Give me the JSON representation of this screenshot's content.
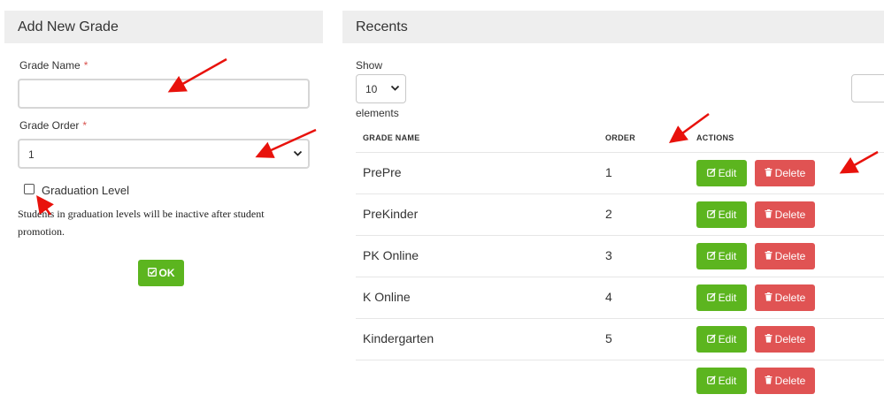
{
  "left_panel": {
    "title": "Add New Grade",
    "grade_name_label": "Grade Name",
    "grade_name_value": "",
    "required_mark": "*",
    "grade_order_label": "Grade Order",
    "grade_order_value": "1",
    "graduation_label": "Graduation Level",
    "graduation_checked": false,
    "help_text": "Students in graduation levels will be inactive after student promotion.",
    "ok_label": "OK"
  },
  "right_panel": {
    "title": "Recents",
    "show_label": "Show",
    "page_size": "10",
    "elements_label": "elements",
    "search_value": "",
    "columns": [
      "GRADE NAME",
      "ORDER",
      "ACTIONS"
    ],
    "edit_label": "Edit",
    "delete_label": "Delete",
    "rows": [
      {
        "name": "PrePre",
        "order": "1"
      },
      {
        "name": "PreKinder",
        "order": "2"
      },
      {
        "name": "PK Online",
        "order": "3"
      },
      {
        "name": "K Online",
        "order": "4"
      },
      {
        "name": "Kindergarten",
        "order": "5"
      }
    ]
  },
  "colors": {
    "accent_green": "#5cb51f",
    "danger_red": "#e05353",
    "annotation_red": "#e8120c"
  },
  "icons": {
    "ok": "check-square-icon",
    "edit": "edit-icon",
    "delete": "trash-icon"
  }
}
